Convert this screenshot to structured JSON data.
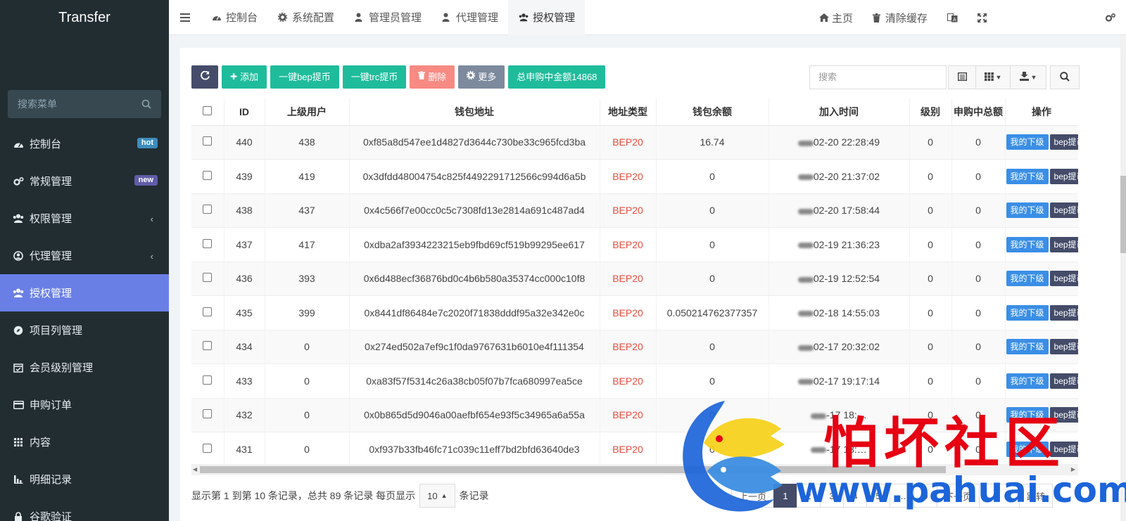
{
  "sidebar": {
    "logo": "Transfer",
    "search_placeholder": "搜索菜单",
    "items": [
      {
        "label": "控制台",
        "badge": "hot"
      },
      {
        "label": "常规管理",
        "badge": "new"
      },
      {
        "label": "权限管理",
        "chevron": "‹"
      },
      {
        "label": "代理管理",
        "chevron": "‹"
      },
      {
        "label": "授权管理"
      },
      {
        "label": "项目列管理"
      },
      {
        "label": "会员级别管理"
      },
      {
        "label": "申购订单"
      },
      {
        "label": "内容"
      },
      {
        "label": "明细记录"
      },
      {
        "label": "谷歌验证"
      }
    ]
  },
  "topbar": {
    "tabs": [
      "控制台",
      "系统配置",
      "管理员管理",
      "代理管理",
      "授权管理"
    ],
    "home": "主页",
    "clear_cache": "清除缓存"
  },
  "toolbar": {
    "add": "添加",
    "bep_withdraw": "一键bep提币",
    "trc_withdraw": "一键trc提币",
    "delete": "删除",
    "more": "更多",
    "total": "总申购中金额14868",
    "search_placeholder": "搜索"
  },
  "table": {
    "headers": [
      "ID",
      "上级用户",
      "钱包地址",
      "地址类型",
      "钱包余额",
      "加入时间",
      "级别",
      "申购中总额",
      "操作"
    ],
    "op_labels": {
      "sub": "我的下级",
      "bep": "bep提币"
    },
    "rows": [
      {
        "id": "440",
        "parent": "438",
        "address": "0xf85a8d547ee1d4827d3644c730be33c965fcd3ba",
        "type": "BEP20",
        "balance": "16.74",
        "time": "02-20 22:28:49",
        "level": "0",
        "total": "0"
      },
      {
        "id": "439",
        "parent": "419",
        "address": "0x3dfdd48004754c825f4492291712566c994d6a5b",
        "type": "BEP20",
        "balance": "0",
        "time": "02-20 21:37:02",
        "level": "0",
        "total": "0"
      },
      {
        "id": "438",
        "parent": "437",
        "address": "0x4c566f7e00cc0c5c7308fd13e2814a691c487ad4",
        "type": "BEP20",
        "balance": "0",
        "time": "02-20 17:58:44",
        "level": "0",
        "total": "0"
      },
      {
        "id": "437",
        "parent": "417",
        "address": "0xdba2af3934223215eb9fbd69cf519b99295ee617",
        "type": "BEP20",
        "balance": "0",
        "time": "02-19 21:36:23",
        "level": "0",
        "total": "0"
      },
      {
        "id": "436",
        "parent": "393",
        "address": "0x6d488ecf36876bd0c4b6b580a35374cc000c10f8",
        "type": "BEP20",
        "balance": "0",
        "time": "02-19 12:52:54",
        "level": "0",
        "total": "0"
      },
      {
        "id": "435",
        "parent": "399",
        "address": "0x8441df86484e7c2020f71838dddf95a32e342e0c",
        "type": "BEP20",
        "balance": "0.050214762377357",
        "time": "02-18 14:55:03",
        "level": "0",
        "total": "0"
      },
      {
        "id": "434",
        "parent": "0",
        "address": "0x274ed502a7ef9c1f0da9767631b6010e4f111354",
        "type": "BEP20",
        "balance": "0",
        "time": "02-17 20:32:02",
        "level": "0",
        "total": "0"
      },
      {
        "id": "433",
        "parent": "0",
        "address": "0xa83f57f5314c26a38cb05f07b7fca680997ea5ce",
        "type": "BEP20",
        "balance": "0",
        "time": "02-17 19:17:14",
        "level": "0",
        "total": "0"
      },
      {
        "id": "432",
        "parent": "0",
        "address": "0x0b865d5d9046a00aefbf654e93f5c34965a6a55a",
        "type": "BEP20",
        "balance": "0",
        "time": "-17 18:…",
        "level": "0",
        "total": "0"
      },
      {
        "id": "431",
        "parent": "0",
        "address": "0xf937b33fb46fc71c039c11eff7bd2bfd63640de3",
        "type": "BEP20",
        "balance": "0",
        "time": "-17 18:…",
        "level": "0",
        "total": "0"
      }
    ]
  },
  "footer": {
    "info_prefix": "显示第 1 到第 10 条记录，总共 89 条记录 每页显示",
    "page_size": "10",
    "info_suffix": "条记录"
  },
  "pagination": [
    "上一页",
    "1",
    "2",
    "3",
    "4",
    "5",
    "…",
    "9",
    "下一页"
  ],
  "pagination_jump": "跳转",
  "watermark": {
    "title": "怕坏社区",
    "url": "www.pahuai.com"
  },
  "colors": {
    "sidebar": "#222d32",
    "active": "#6a7fe6",
    "green": "#1fbc9c",
    "dark": "#444c69",
    "red_text": "#e74c3c"
  }
}
